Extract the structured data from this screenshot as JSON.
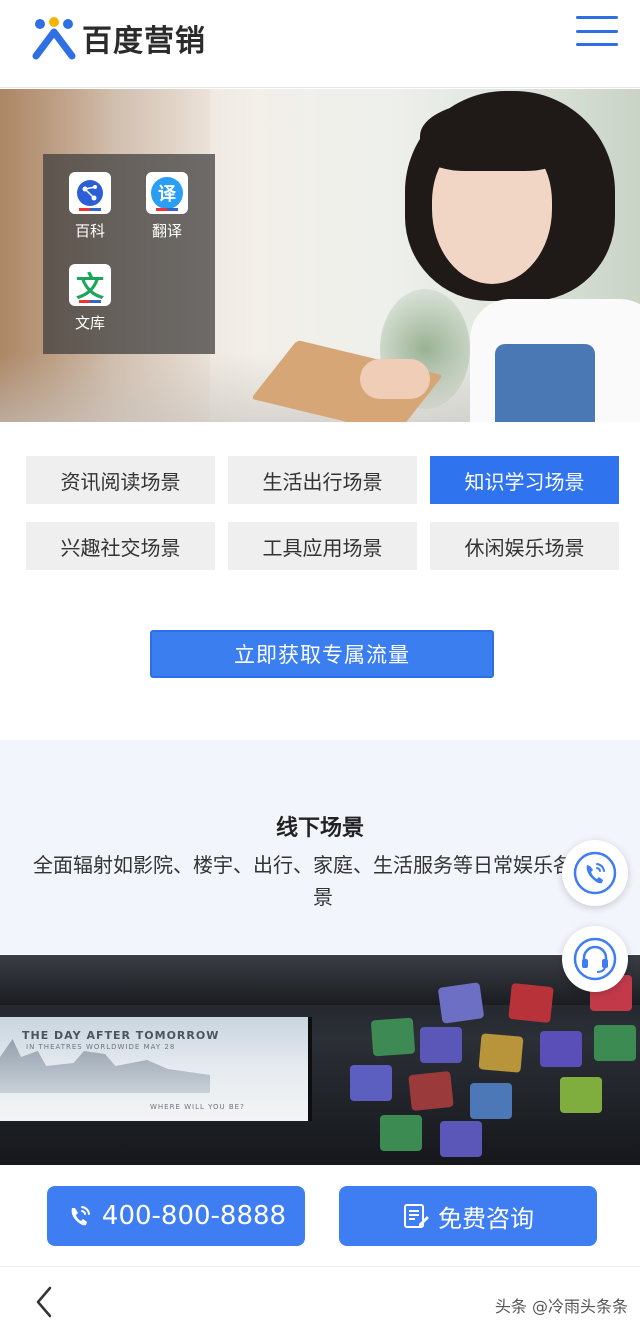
{
  "header": {
    "logo_text": "百度营销",
    "brand_color": "#2f6fe4"
  },
  "hero": {
    "apps": [
      {
        "label": "百科",
        "icon": "baike-icon"
      },
      {
        "label": "翻译",
        "icon": "translate-icon",
        "glyph": "译"
      },
      {
        "label": "文库",
        "icon": "wenku-icon",
        "glyph": "文"
      }
    ]
  },
  "scene_tabs": [
    {
      "label": "资讯阅读场景",
      "active": false
    },
    {
      "label": "生活出行场景",
      "active": false
    },
    {
      "label": "知识学习场景",
      "active": true
    },
    {
      "label": "兴趣社交场景",
      "active": false
    },
    {
      "label": "工具应用场景",
      "active": false
    },
    {
      "label": "休闲娱乐场景",
      "active": false
    }
  ],
  "cta": {
    "label": "立即获取专属流量"
  },
  "offline": {
    "title": "线下场景",
    "description": "全面辐射如影院、楼宇、出行、家庭、生活服务等日常娱乐各个场景"
  },
  "cinema": {
    "screen_title": "THE DAY AFTER TOMORROW",
    "screen_subtitle": "IN THEATRES WORLDWIDE MAY 28",
    "screen_tagline": "WHERE WILL YOU BE?"
  },
  "bottom_bar": {
    "phone": "400-800-8888",
    "consult": "免费咨询"
  },
  "nav": {
    "watermark": "头条 @冷雨头条条"
  }
}
